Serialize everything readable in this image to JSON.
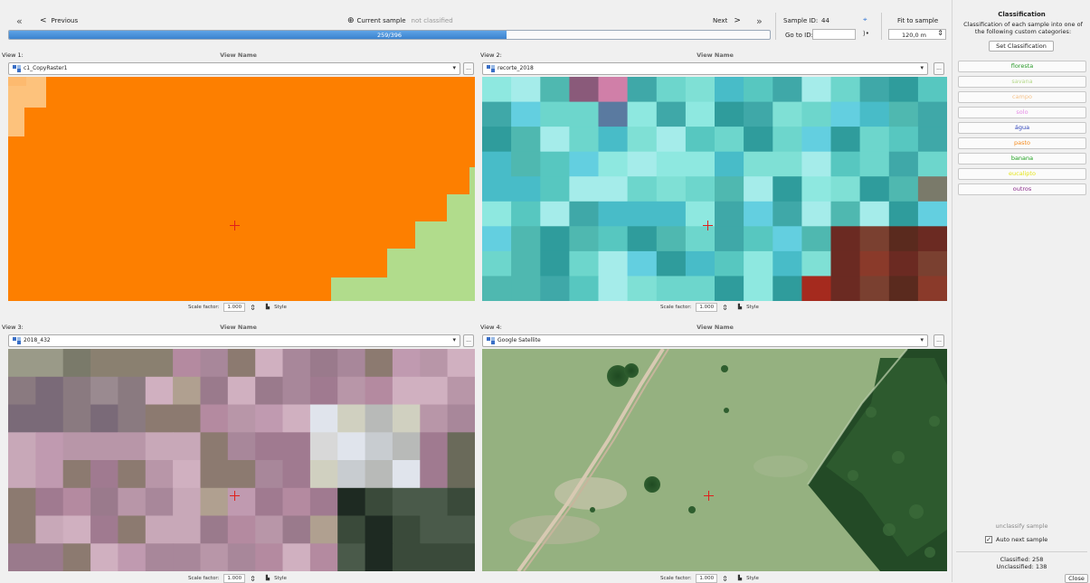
{
  "nav": {
    "first_icon": "«",
    "previous_label": "Previous",
    "current_sample_label": "Current sample",
    "classification_status": "not classified",
    "next_label": "Next",
    "last_icon": "»",
    "progress_text": "259/396",
    "progress_fraction": 0.654
  },
  "sample": {
    "id_label": "Sample ID:",
    "id_value": "44",
    "goto_label": "Go to ID:",
    "goto_value": "",
    "fit_label": "Fit to sample",
    "fit_value": "120,0 m"
  },
  "views": [
    {
      "label": "View 1:",
      "name_placeholder": "View Name",
      "layer": "c1_CopyRaster1",
      "scale_label": "Scale factor:",
      "scale_value": "1.000",
      "style_label": "Style"
    },
    {
      "label": "View 2:",
      "name_placeholder": "View Name",
      "layer": "recorte_2018",
      "scale_label": "Scale factor:",
      "scale_value": "1.000",
      "style_label": "Style"
    },
    {
      "label": "View 3:",
      "name_placeholder": "View Name",
      "layer": "2018_432",
      "scale_label": "Scale factor:",
      "scale_value": "1.000",
      "style_label": "Style"
    },
    {
      "label": "View 4:",
      "name_placeholder": "View Name",
      "layer": "Google Satellite",
      "scale_label": "Scale factor:",
      "scale_value": "1.000",
      "style_label": "Style"
    }
  ],
  "classification": {
    "title": "Classification",
    "description": "Classification of each sample into one of the following custom categories:",
    "set_button": "Set Classification",
    "categories": [
      {
        "label": "floresta",
        "color": "#2a9a2a"
      },
      {
        "label": "savana",
        "color": "#b5d98a"
      },
      {
        "label": "campo",
        "color": "#f6c38a"
      },
      {
        "label": "solo",
        "color": "#e58ae5"
      },
      {
        "label": "água",
        "color": "#2a3fb8"
      },
      {
        "label": "pasto",
        "color": "#f58a1c"
      },
      {
        "label": "banana",
        "color": "#1ca01c"
      },
      {
        "label": "eucalipto",
        "color": "#e5e51c"
      },
      {
        "label": "outros",
        "color": "#8a2a8a"
      }
    ],
    "unclassify_label": "unclassify sample",
    "auto_next_label": "Auto next sample",
    "auto_next_checked": true,
    "classified_text": "Classified: 258",
    "unclassified_text": "Unclassified: 138",
    "close_label": "Close"
  }
}
